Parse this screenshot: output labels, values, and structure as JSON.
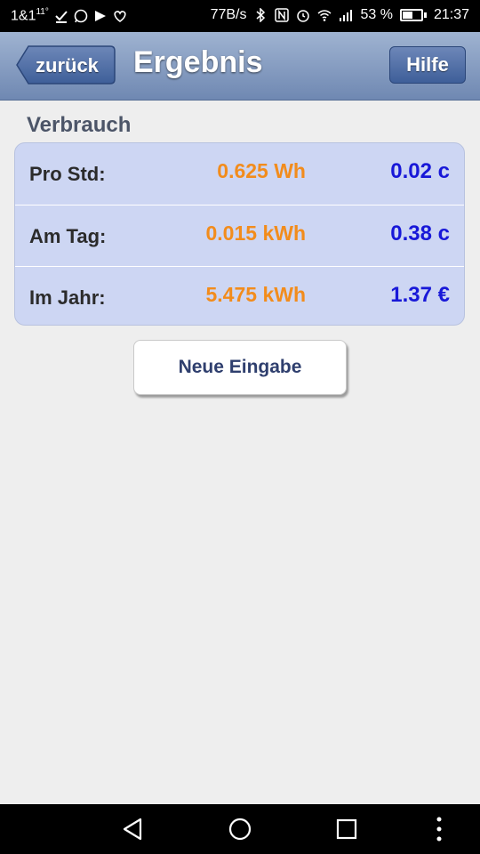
{
  "status_bar": {
    "carrier": "1&1",
    "carrier_superscript": "11°",
    "network_speed": "77B/s",
    "battery_percent": "53 %",
    "battery_level": 0.53,
    "time": "21:37",
    "icons_left": [
      "check-icon",
      "whatsapp-icon",
      "message-icon",
      "heart-icon"
    ],
    "icons_right": [
      "bluetooth-icon",
      "nfc-icon",
      "alarm-icon",
      "wifi-icon",
      "signal-icon"
    ]
  },
  "header": {
    "back_label": "zurück",
    "title": "Ergebnis",
    "help_label": "Hilfe",
    "gradient_top": "#9fb3d1",
    "gradient_bottom": "#6f88b2"
  },
  "section": {
    "title": "Verbrauch"
  },
  "results": [
    {
      "label": "Pro Std:",
      "energy": "0.625 Wh",
      "cost": "0.02 c"
    },
    {
      "label": "Am Tag:",
      "energy": "0.015 kWh",
      "cost": "0.38 c"
    },
    {
      "label": "Im Jahr:",
      "energy": "5.475 kWh",
      "cost": "1.37 €"
    }
  ],
  "colors": {
    "energy": "#f28c1c",
    "cost": "#1818d8",
    "table_bg": "#cdd6f3"
  },
  "actions": {
    "new_entry_label": "Neue Eingabe"
  },
  "nav_bar": {
    "items": [
      "back-icon",
      "home-icon",
      "recents-icon",
      "more-icon"
    ]
  }
}
